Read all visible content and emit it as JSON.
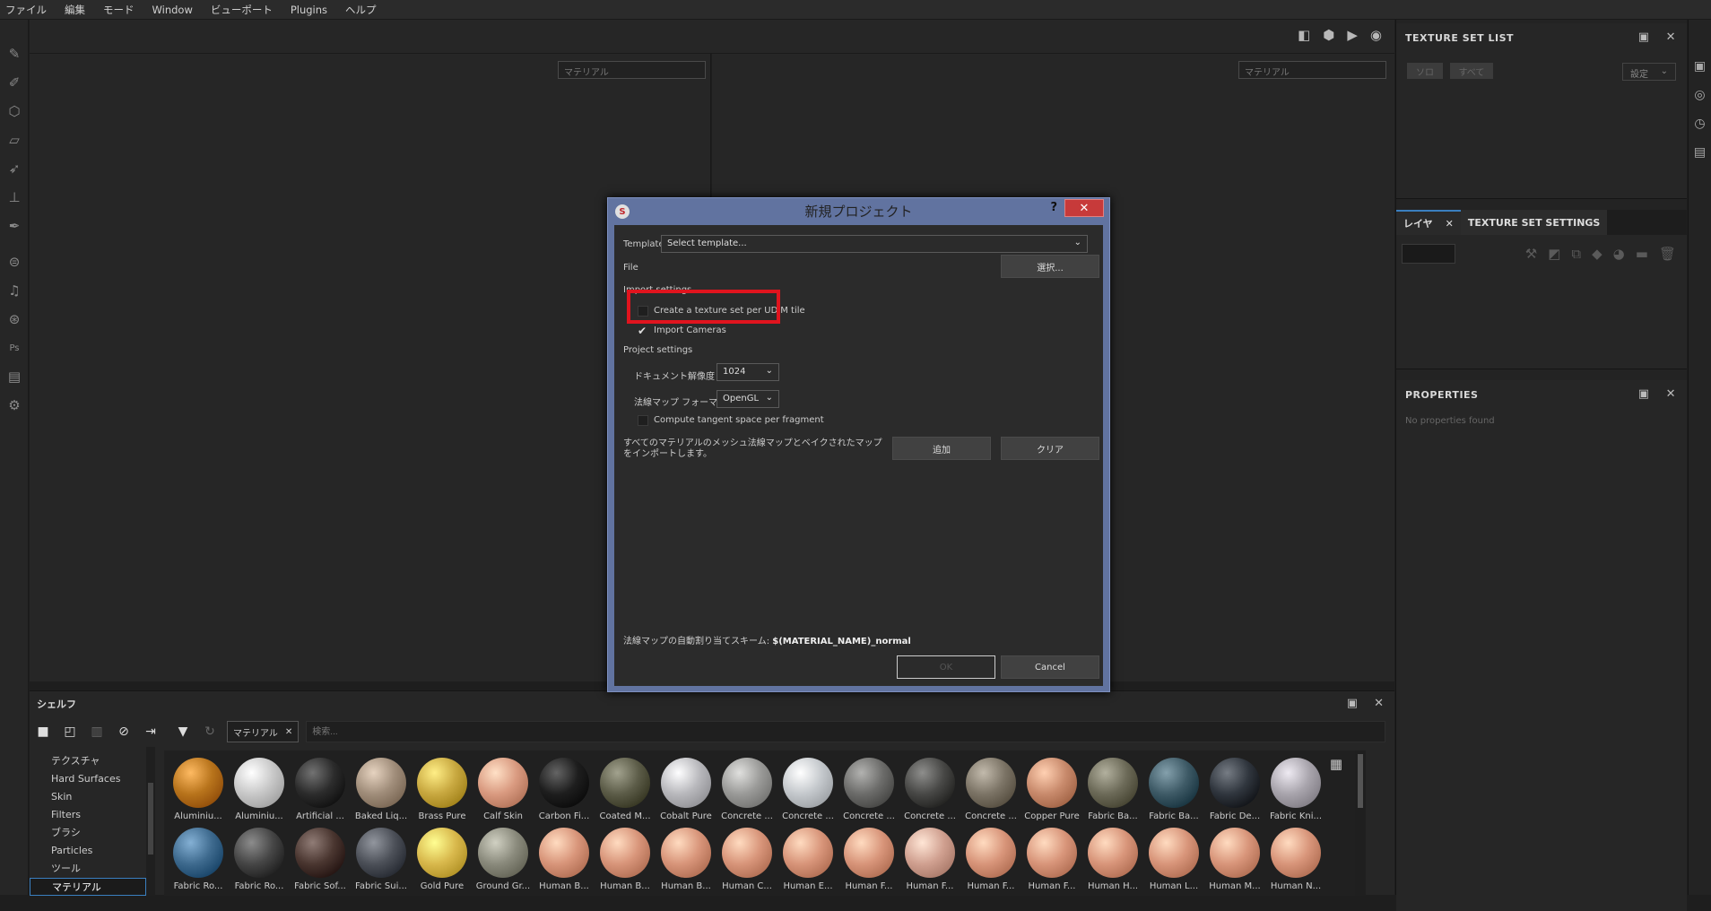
{
  "menu": [
    "ファイル",
    "編集",
    "モード",
    "Window",
    "ビューポート",
    "Plugins",
    "ヘルプ"
  ],
  "viewport": {
    "left_select": "マテリアル",
    "right_select": "マテリアル"
  },
  "right_panel": {
    "texture_set_list": {
      "title": "TEXTURE SET LIST",
      "chip_solo": "ソロ",
      "chip_all": "すべて",
      "settings": "設定"
    },
    "tabs": {
      "layer": "レイヤ",
      "texture_set_settings": "TEXTURE SET SETTINGS"
    },
    "properties": {
      "title": "PROPERTIES",
      "empty": "No properties found"
    }
  },
  "shelf": {
    "title": "シェルフ",
    "filter_chip": "マテリアル",
    "search_placeholder": "検索...",
    "categories": [
      "テクスチャ",
      "Hard Surfaces",
      "Skin",
      "Filters",
      "ブラシ",
      "Particles",
      "ツール",
      "マテリアル"
    ],
    "selected_category": "マテリアル",
    "materials_row1": [
      {
        "label": "Aluminiu...",
        "color": "#b8741c"
      },
      {
        "label": "Aluminiu...",
        "color": "#c8c8c8"
      },
      {
        "label": "Artificial ...",
        "color": "#2c2c2c"
      },
      {
        "label": "Baked Liq...",
        "color": "#a08d7a"
      },
      {
        "label": "Brass Pure",
        "color": "#c8a840"
      },
      {
        "label": "Calf Skin",
        "color": "#d99a80"
      },
      {
        "label": "Carbon Fi...",
        "color": "#1e1e1e"
      },
      {
        "label": "Coated M...",
        "color": "#5c5c48"
      },
      {
        "label": "Cobalt Pure",
        "color": "#b8b8bc"
      },
      {
        "label": "Concrete ...",
        "color": "#9a9a98"
      },
      {
        "label": "Concrete ...",
        "color": "#c4c8cc"
      },
      {
        "label": "Concrete ...",
        "color": "#6c6c6a"
      },
      {
        "label": "Concrete ...",
        "color": "#484846"
      },
      {
        "label": "Concrete ...",
        "color": "#7c7466"
      },
      {
        "label": "Copper Pure",
        "color": "#c88a6c"
      },
      {
        "label": "Fabric Ba...",
        "color": "#6c6a58"
      },
      {
        "label": "Fabric Ba...",
        "color": "#3e5a66"
      },
      {
        "label": "Fabric De...",
        "color": "#30363e"
      },
      {
        "label": "Fabric Kni...",
        "color": "#a8a4ac"
      }
    ],
    "materials_row2": [
      {
        "label": "Fabric Ro...",
        "color": "#3e6a8e"
      },
      {
        "label": "Fabric Ro...",
        "color": "#464646"
      },
      {
        "label": "Fabric Sof...",
        "color": "#4a3630"
      },
      {
        "label": "Fabric Sui...",
        "color": "#4c5058"
      },
      {
        "label": "Gold Pure",
        "color": "#d8b84c"
      },
      {
        "label": "Ground Gr...",
        "color": "#8a8a7c"
      },
      {
        "label": "Human B...",
        "color": "#d8957a"
      },
      {
        "label": "Human B...",
        "color": "#d8957a"
      },
      {
        "label": "Human B...",
        "color": "#d8957a"
      },
      {
        "label": "Human C...",
        "color": "#d8957a"
      },
      {
        "label": "Human E...",
        "color": "#d8957a"
      },
      {
        "label": "Human F...",
        "color": "#d8957a"
      },
      {
        "label": "Human F...",
        "color": "#d0a090"
      },
      {
        "label": "Human F...",
        "color": "#d8957a"
      },
      {
        "label": "Human F...",
        "color": "#d8957a"
      },
      {
        "label": "Human H...",
        "color": "#d8957a"
      },
      {
        "label": "Human L...",
        "color": "#d8957a"
      },
      {
        "label": "Human M...",
        "color": "#d8957a"
      },
      {
        "label": "Human N...",
        "color": "#d8957a"
      }
    ]
  },
  "dialog": {
    "title": "新規プロジェクト",
    "help": "?",
    "template_label": "Template",
    "template_value": "Select template...",
    "file_label": "File",
    "file_button": "選択...",
    "import_settings": "Import settings",
    "udim_label": "Create a texture set per UDIM tile",
    "cameras_label": "Import Cameras",
    "project_settings": "Project settings",
    "resolution_label": "ドキュメント解像度",
    "resolution_value": "1024",
    "normal_format_label": "法線マップ フォーマット",
    "normal_format_value": "OpenGL",
    "tangent_label": "Compute tangent space per fragment",
    "import_mesh_label": "すべてのマテリアルのメッシュ法線マップとベイクされたマップをインポートします。",
    "add_button": "追加",
    "clear_button": "クリア",
    "scheme_label": "法線マップの自動割り当てスキーム: ",
    "scheme_value": "$(MATERIAL_NAME)_normal",
    "ok_button": "OK",
    "cancel_button": "Cancel"
  }
}
